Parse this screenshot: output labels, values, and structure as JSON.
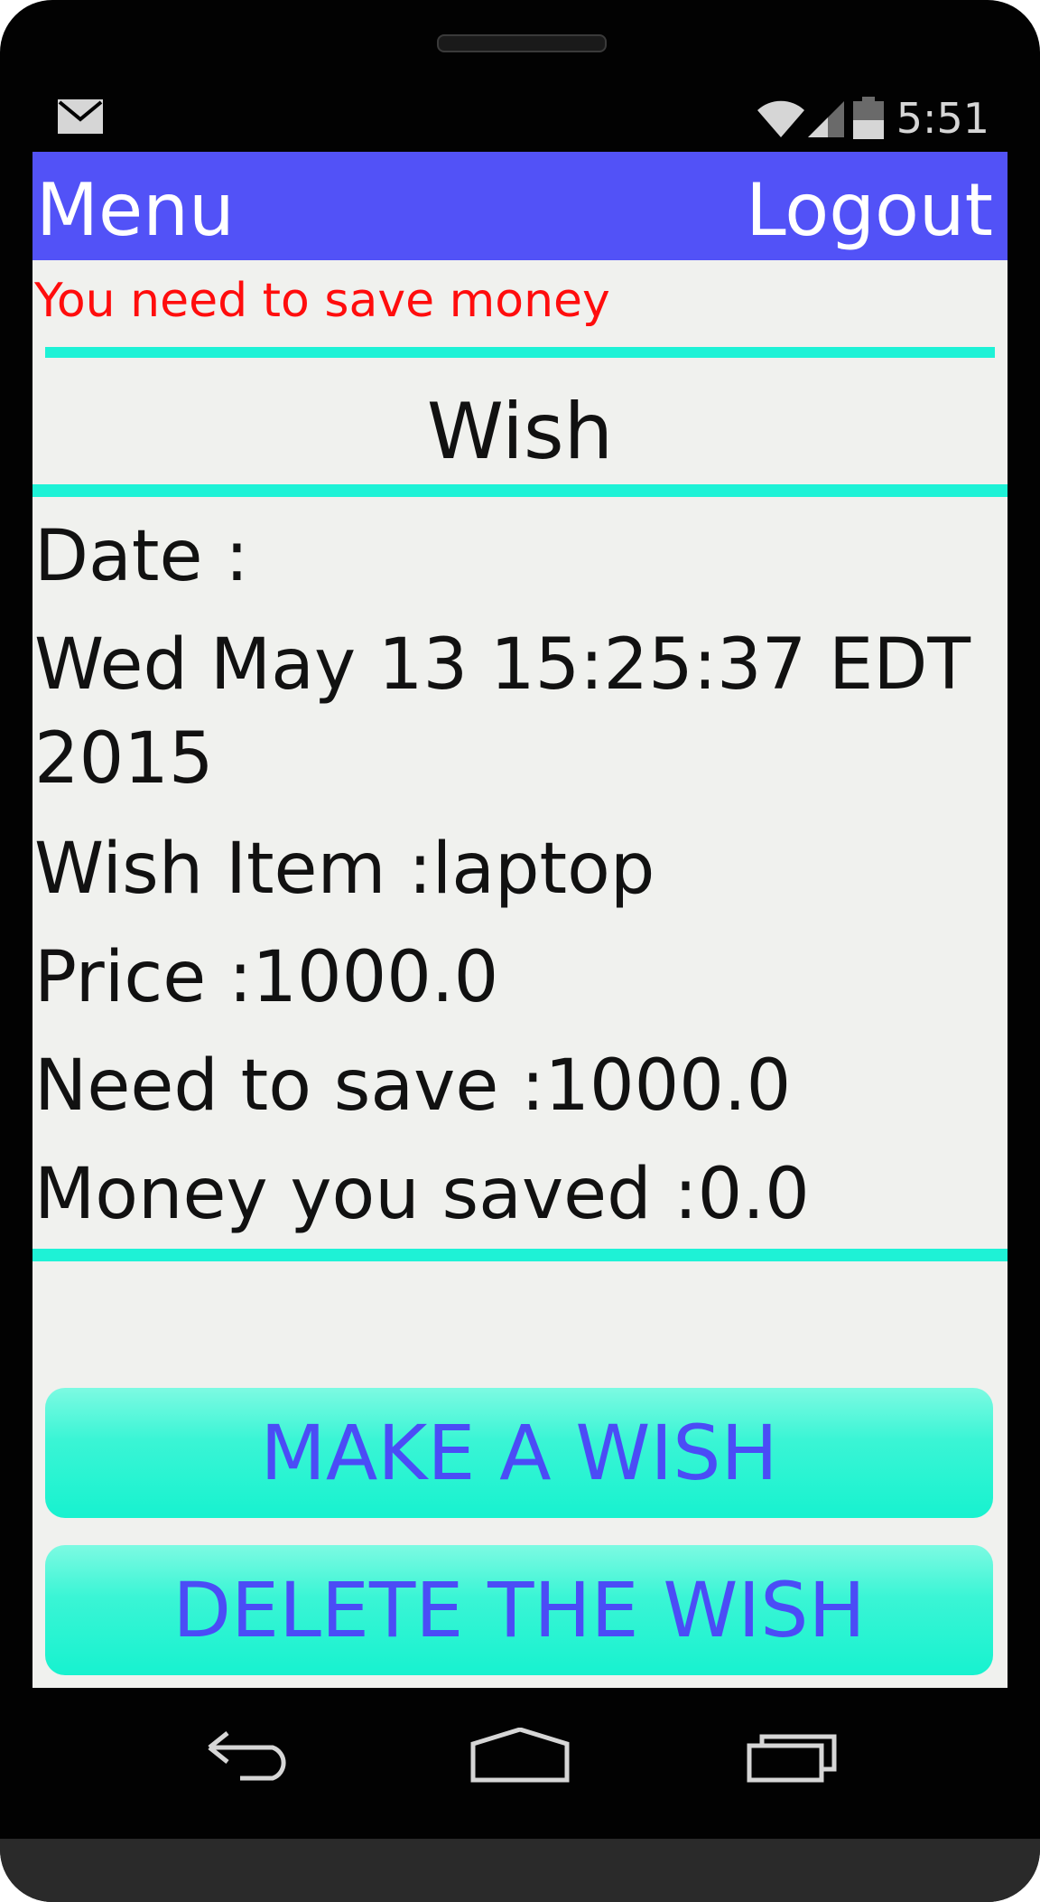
{
  "status_bar": {
    "time": "5:51"
  },
  "action_bar": {
    "menu_label": "Menu",
    "logout_label": "Logout"
  },
  "warning_text": "You need to save money",
  "section_title": "Wish",
  "details": {
    "date_label": "Date :",
    "date_value": "Wed May 13 15:25:37 EDT 2015",
    "wish_item": "Wish Item :laptop",
    "price": "Price :1000.0",
    "need_to_save": "Need to save :1000.0",
    "money_saved": "Money you saved :0.0"
  },
  "buttons": {
    "make_wish": "MAKE A WISH",
    "delete_wish": "DELETE THE WISH"
  },
  "colors": {
    "action_bar": "#5252f7",
    "accent": "#1ef2d6",
    "warning": "#ff0d0d",
    "button_text": "#4b4cf6"
  },
  "icons": [
    "mail-icon",
    "wifi-icon",
    "signal-icon",
    "battery-icon",
    "back-icon",
    "home-icon",
    "recent-apps-icon"
  ]
}
